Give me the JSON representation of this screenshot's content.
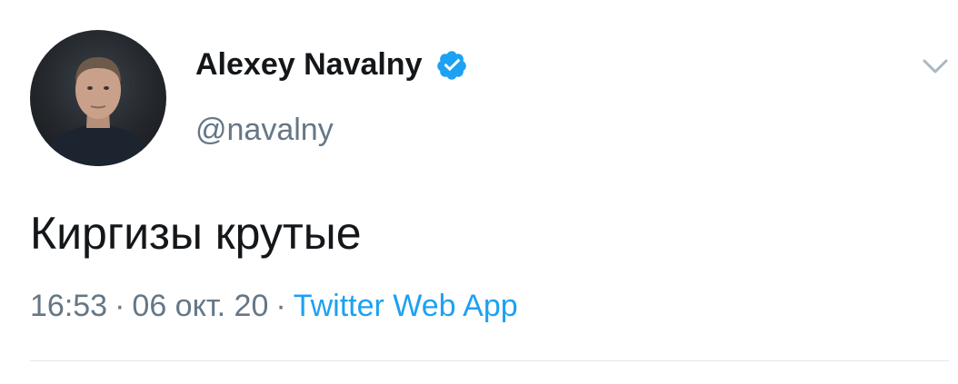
{
  "author": {
    "display_name": "Alexey Navalny",
    "handle": "@navalny",
    "verified": true
  },
  "tweet": {
    "text": "Киргизы крутые",
    "time": "16:53",
    "separator": "·",
    "date": "06 окт. 20",
    "source": "Twitter Web App"
  },
  "icons": {
    "verified": "verified-badge-icon",
    "more": "chevron-down-icon"
  },
  "colors": {
    "text": "#14171a",
    "secondary": "#657786",
    "link": "#1da1f2",
    "verified": "#1da1f2",
    "divider": "#e1e8ed"
  }
}
